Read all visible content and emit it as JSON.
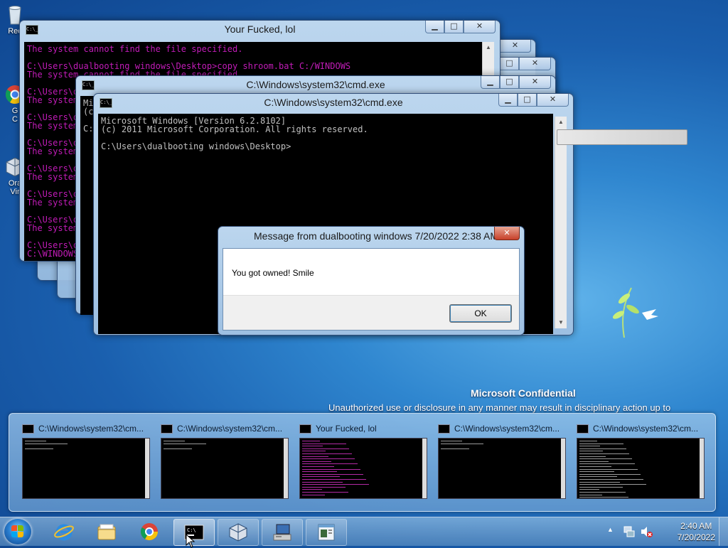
{
  "desktop": {
    "icons": [
      {
        "label": "Rec",
        "name": "recycle-bin"
      },
      {
        "label": "G\nC",
        "name": "google-chrome"
      },
      {
        "label": "Ora\nVir",
        "name": "oracle-virtualbox"
      }
    ],
    "confidential_title": "Microsoft Confidential",
    "confidential_notice": "Unauthorized use or disclosure in any manner may result in disciplinary action up to"
  },
  "windows": {
    "fucked": {
      "title": "Your Fucked, lol",
      "lines": [
        "The system cannot find the file specified.",
        "",
        "C:\\Users\\dualbooting windows\\Desktop>copy shroom.bat C:/WINDOWS",
        "The system cannot find the file specified.",
        "",
        "C:\\Users\\dualbooting windows\\Desktop>copy shroom.bat C:/WINDOWS",
        "The system cannot find the file specified.",
        "",
        "C:\\Users\\dualbooting windows\\Desktop>copy shroom.bat C:/WINDOWS",
        "The system cannot find the file specified.",
        "",
        "C:\\Users\\dualbooting windows\\Desktop>copy shroom.bat C:/WINDOWS",
        "The system cannot find the file specified.",
        "",
        "C:\\Users\\dualbooting windows\\Desktop>copy shroom.bat C:/WINDOWS",
        "The system cannot find the file specified.",
        "",
        "C:\\Users\\dualbooting windows\\Desktop>copy shroom.bat C:/WINDOWS",
        "The system cannot find the file specified.",
        "",
        "C:\\Users\\dualbooting windows\\Desktop>copy shroom.bat C:/WINDOWS",
        "The system cannot find the file specified.",
        "",
        "C:\\Users\\dualbooting windows\\Desktop>copy shroom.bat C:/WINDOWS",
        "C:\\WINDOWS"
      ]
    },
    "cmd_back": {
      "title": "C:\\Windows\\system32\\cmd.exe",
      "lines": [
        "Mi",
        "(c",
        "",
        "C:"
      ]
    },
    "cmd_front": {
      "title": "C:\\Windows\\system32\\cmd.exe",
      "lines": [
        "Microsoft Windows [Version 6.2.8102]",
        "(c) 2011 Microsoft Corporation. All rights reserved.",
        "",
        "C:\\Users\\dualbooting windows\\Desktop>"
      ]
    },
    "controls": {
      "minimize": "▁",
      "maximize": "□",
      "close": "✕"
    }
  },
  "dialog": {
    "title": "Message from dualbooting windows 7/20/2022 2:38 AM",
    "message": "You got owned! Smile",
    "ok_label": "OK",
    "close_label": "✕"
  },
  "thumbnails": [
    {
      "title": "C:\\Windows\\system32\\cm...",
      "style": "cmd"
    },
    {
      "title": "C:\\Windows\\system32\\cm...",
      "style": "cmd"
    },
    {
      "title": "Your Fucked, lol",
      "style": "magenta"
    },
    {
      "title": "C:\\Windows\\system32\\cm...",
      "style": "cmd"
    },
    {
      "title": "C:\\Windows\\system32\\cm...",
      "style": "dir"
    }
  ],
  "taskbar": {
    "items": [
      {
        "name": "internet-explorer-icon"
      },
      {
        "name": "file-explorer-icon"
      },
      {
        "name": "chrome-icon"
      },
      {
        "name": "cmd-icon",
        "state": "active"
      },
      {
        "name": "virtualbox-icon",
        "state": "open"
      },
      {
        "name": "network-computer-icon",
        "state": "open"
      },
      {
        "name": "notepad-icon",
        "state": "open"
      }
    ],
    "time": "2:40 AM",
    "date": "7/20/2022"
  },
  "colors": {
    "console_text": "#c0c0c0",
    "console_magenta": "#c21cb8",
    "desktop_blue": "#1a5fae"
  }
}
